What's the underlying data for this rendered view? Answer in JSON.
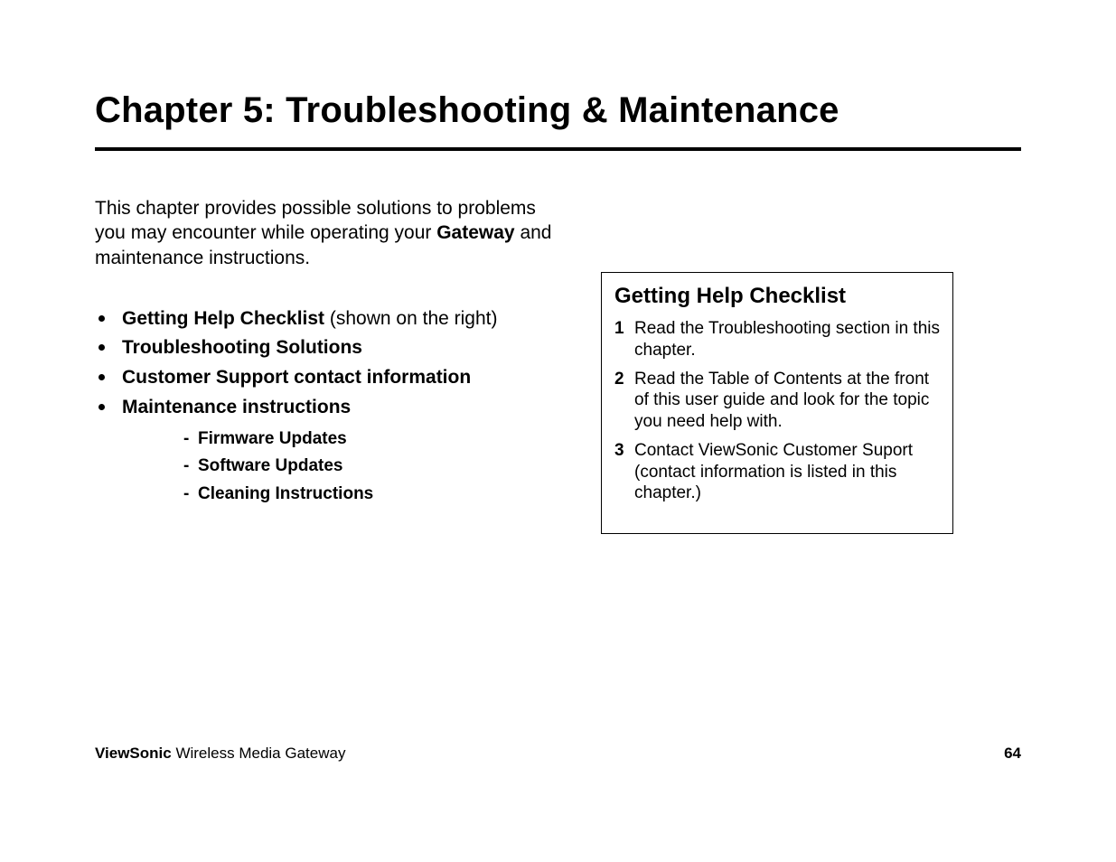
{
  "title": "Chapter 5:  Troubleshooting & Maintenance",
  "intro": {
    "part1": "This chapter provides possible solutions to problems you may encounter while operating your ",
    "bold": "Gateway",
    "part2": " and maintenance instructions."
  },
  "topics": {
    "item0_bold": "Getting Help Checklist",
    "item0_rest": " (shown on the right)",
    "item1": "Troubleshooting Solutions",
    "item2": "Customer Support contact information",
    "item3": "Maintenance instructions",
    "sub0": "Firmware Updates",
    "sub1": "Software Updates",
    "sub2": "Cleaning Instructions"
  },
  "sidebar": {
    "title": "Getting Help Checklist",
    "items": [
      "Read the Troubleshooting section in this chapter.",
      "Read the Table of Contents at the front of this user guide and look for the topic you need help with.",
      "Contact ViewSonic Customer Suport (contact information is listed in this chapter.)"
    ]
  },
  "footer": {
    "brand": "ViewSonic",
    "product": " Wireless Media Gateway",
    "page": "64"
  }
}
